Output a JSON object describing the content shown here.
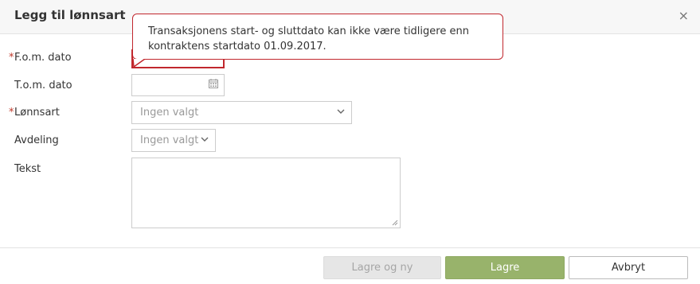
{
  "dialog": {
    "title": "Legg til lønnsart",
    "close_icon": "×"
  },
  "form": {
    "required_marker": "*",
    "fom_label": "F.o.m. dato",
    "tom_label": "T.o.m. dato",
    "lonnsart_label": "Lønnsart",
    "lonnsart_placeholder": "Ingen valgt",
    "avdeling_label": "Avdeling",
    "avdeling_placeholder": "Ingen valgt",
    "tekst_label": "Tekst"
  },
  "tooltip": {
    "text": "Transaksjonens start- og sluttdato kan ikke være tidligere enn kontraktens startdato 01.09.2017."
  },
  "footer": {
    "save_new_label": "Lagre og ny",
    "save_label": "Lagre",
    "cancel_label": "Avbryt"
  },
  "colors": {
    "error": "#c1272d",
    "primary": "#98b36b",
    "disabled": "#e6e6e6"
  }
}
